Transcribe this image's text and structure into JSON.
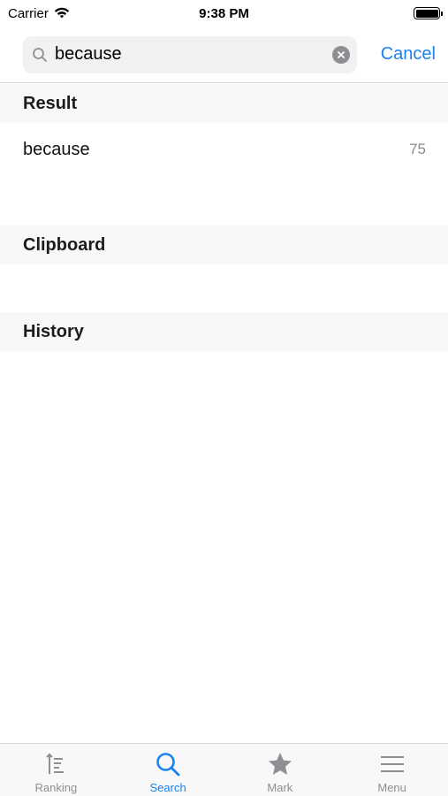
{
  "status_bar": {
    "carrier": "Carrier",
    "time": "9:38 PM"
  },
  "search": {
    "value": "because",
    "cancel_label": "Cancel"
  },
  "sections": {
    "result": {
      "title": "Result",
      "items": [
        {
          "word": "because",
          "count": "75"
        }
      ]
    },
    "clipboard": {
      "title": "Clipboard"
    },
    "history": {
      "title": "History"
    }
  },
  "tabs": [
    {
      "label": "Ranking",
      "icon": "ranking-icon",
      "active": false
    },
    {
      "label": "Search",
      "icon": "search-icon",
      "active": true
    },
    {
      "label": "Mark",
      "icon": "star-icon",
      "active": false
    },
    {
      "label": "Menu",
      "icon": "menu-icon",
      "active": false
    }
  ],
  "colors": {
    "accent": "#1a82f0",
    "inactive": "#8e8e93",
    "section_bg": "#f7f7f7"
  }
}
